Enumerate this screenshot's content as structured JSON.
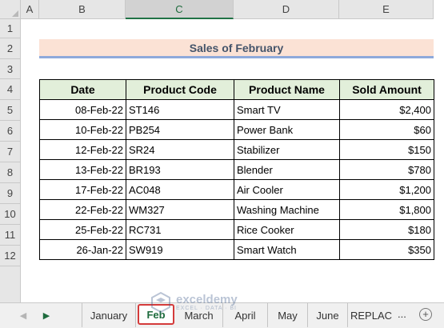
{
  "columns": [
    "A",
    "B",
    "C",
    "D",
    "E"
  ],
  "rows": [
    "1",
    "2",
    "3",
    "4",
    "5",
    "6",
    "7",
    "8",
    "9",
    "10",
    "11",
    "12"
  ],
  "sheet_title": "Sales of February",
  "table": {
    "headers": [
      "Date",
      "Product Code",
      "Product Name",
      "Sold Amount"
    ],
    "rows": [
      {
        "date": "08-Feb-22",
        "code": "ST146",
        "name": "Smart TV",
        "amount": "$2,400"
      },
      {
        "date": "10-Feb-22",
        "code": "PB254",
        "name": "Power Bank",
        "amount": "$60"
      },
      {
        "date": "12-Feb-22",
        "code": "SR24",
        "name": "Stabilizer",
        "amount": "$150"
      },
      {
        "date": "13-Feb-22",
        "code": "BR193",
        "name": "Blender",
        "amount": "$780"
      },
      {
        "date": "17-Feb-22",
        "code": "AC048",
        "name": "Air Cooler",
        "amount": "$1,200"
      },
      {
        "date": "22-Feb-22",
        "code": "WM327",
        "name": "Washing Machine",
        "amount": "$1,800"
      },
      {
        "date": "25-Feb-22",
        "code": "RC731",
        "name": "Rice Cooker",
        "amount": "$180"
      },
      {
        "date": "26-Jan-22",
        "code": "SW919",
        "name": "Smart Watch",
        "amount": "$350"
      }
    ]
  },
  "sheet_tabs": {
    "nav_prev": "◀",
    "nav_next": "▶",
    "tabs": [
      "January",
      "Feb",
      "March",
      "April",
      "May",
      "June",
      "REPLAC"
    ],
    "active": "Feb",
    "more": "...",
    "add": "+"
  },
  "watermark": {
    "name": "exceldemy",
    "sub": "EXCEL · DATA · BI"
  },
  "colors": {
    "title_fill": "#fbe2d5",
    "header_fill": "#e2efda",
    "active_tab_border": "#d43b3b",
    "excel_green": "#217346"
  }
}
